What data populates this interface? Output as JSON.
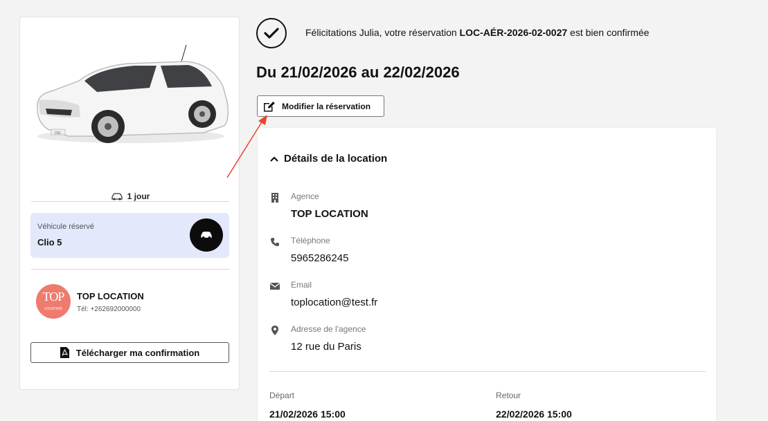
{
  "left": {
    "duration": "1 jour",
    "vehicle_caption": "Véhicule réservé",
    "vehicle_name": "Clio 5",
    "car_plate_text": "DEL",
    "agency_logo_main": "TOP",
    "agency_logo_sub": "LOCATION",
    "agency_name": "TOP LOCATION",
    "agency_tel": "Tél: +262692000000",
    "download_label": "Télécharger ma confirmation"
  },
  "header": {
    "confirm_prefix": "Félicitations Julia, votre réservation ",
    "reservation_code": "LOC-AÉR-2026-02-0027",
    "confirm_suffix": " est bien confirmée",
    "date_range": "Du 21/02/2026 au 22/02/2026",
    "modify_label": "Modifier la réservation"
  },
  "details": {
    "title": "Détails de la location",
    "rows": [
      {
        "icon": "building-icon",
        "label": "Agence",
        "value": "TOP LOCATION"
      },
      {
        "icon": "phone-icon",
        "label": "Téléphone",
        "value": "5965286245"
      },
      {
        "icon": "envelope-icon",
        "label": "Email",
        "value": "toplocation@test.fr"
      },
      {
        "icon": "map-marker-icon",
        "label": "Adresse de l'agence",
        "value": "12 rue du Paris"
      }
    ],
    "departure_label": "Départ",
    "departure_value": "21/02/2026 15:00",
    "return_label": "Retour",
    "return_value": "22/02/2026 15:00"
  },
  "colors": {
    "vehicle_box_bg": "#e3e8fb",
    "agency_logo_bg": "#ee7b6d",
    "annotation_arrow": "#e8452c"
  }
}
